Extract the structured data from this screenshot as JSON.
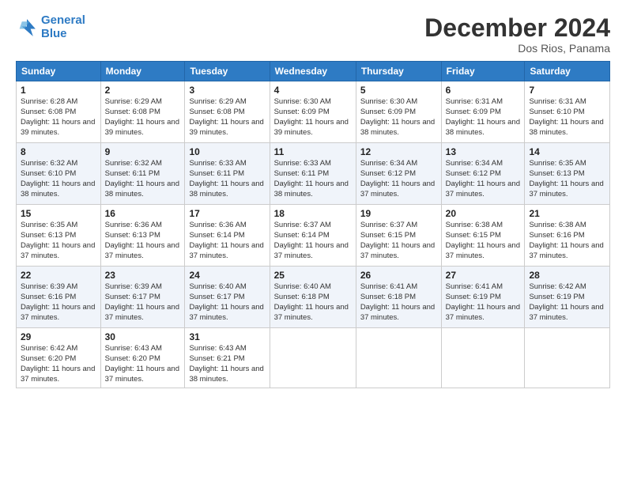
{
  "header": {
    "logo_line1": "General",
    "logo_line2": "Blue",
    "month_title": "December 2024",
    "location": "Dos Rios, Panama"
  },
  "weekdays": [
    "Sunday",
    "Monday",
    "Tuesday",
    "Wednesday",
    "Thursday",
    "Friday",
    "Saturday"
  ],
  "weeks": [
    [
      {
        "day": "1",
        "info": "Sunrise: 6:28 AM\nSunset: 6:08 PM\nDaylight: 11 hours and 39 minutes."
      },
      {
        "day": "2",
        "info": "Sunrise: 6:29 AM\nSunset: 6:08 PM\nDaylight: 11 hours and 39 minutes."
      },
      {
        "day": "3",
        "info": "Sunrise: 6:29 AM\nSunset: 6:08 PM\nDaylight: 11 hours and 39 minutes."
      },
      {
        "day": "4",
        "info": "Sunrise: 6:30 AM\nSunset: 6:09 PM\nDaylight: 11 hours and 39 minutes."
      },
      {
        "day": "5",
        "info": "Sunrise: 6:30 AM\nSunset: 6:09 PM\nDaylight: 11 hours and 38 minutes."
      },
      {
        "day": "6",
        "info": "Sunrise: 6:31 AM\nSunset: 6:09 PM\nDaylight: 11 hours and 38 minutes."
      },
      {
        "day": "7",
        "info": "Sunrise: 6:31 AM\nSunset: 6:10 PM\nDaylight: 11 hours and 38 minutes."
      }
    ],
    [
      {
        "day": "8",
        "info": "Sunrise: 6:32 AM\nSunset: 6:10 PM\nDaylight: 11 hours and 38 minutes."
      },
      {
        "day": "9",
        "info": "Sunrise: 6:32 AM\nSunset: 6:11 PM\nDaylight: 11 hours and 38 minutes."
      },
      {
        "day": "10",
        "info": "Sunrise: 6:33 AM\nSunset: 6:11 PM\nDaylight: 11 hours and 38 minutes."
      },
      {
        "day": "11",
        "info": "Sunrise: 6:33 AM\nSunset: 6:11 PM\nDaylight: 11 hours and 38 minutes."
      },
      {
        "day": "12",
        "info": "Sunrise: 6:34 AM\nSunset: 6:12 PM\nDaylight: 11 hours and 37 minutes."
      },
      {
        "day": "13",
        "info": "Sunrise: 6:34 AM\nSunset: 6:12 PM\nDaylight: 11 hours and 37 minutes."
      },
      {
        "day": "14",
        "info": "Sunrise: 6:35 AM\nSunset: 6:13 PM\nDaylight: 11 hours and 37 minutes."
      }
    ],
    [
      {
        "day": "15",
        "info": "Sunrise: 6:35 AM\nSunset: 6:13 PM\nDaylight: 11 hours and 37 minutes."
      },
      {
        "day": "16",
        "info": "Sunrise: 6:36 AM\nSunset: 6:13 PM\nDaylight: 11 hours and 37 minutes."
      },
      {
        "day": "17",
        "info": "Sunrise: 6:36 AM\nSunset: 6:14 PM\nDaylight: 11 hours and 37 minutes."
      },
      {
        "day": "18",
        "info": "Sunrise: 6:37 AM\nSunset: 6:14 PM\nDaylight: 11 hours and 37 minutes."
      },
      {
        "day": "19",
        "info": "Sunrise: 6:37 AM\nSunset: 6:15 PM\nDaylight: 11 hours and 37 minutes."
      },
      {
        "day": "20",
        "info": "Sunrise: 6:38 AM\nSunset: 6:15 PM\nDaylight: 11 hours and 37 minutes."
      },
      {
        "day": "21",
        "info": "Sunrise: 6:38 AM\nSunset: 6:16 PM\nDaylight: 11 hours and 37 minutes."
      }
    ],
    [
      {
        "day": "22",
        "info": "Sunrise: 6:39 AM\nSunset: 6:16 PM\nDaylight: 11 hours and 37 minutes."
      },
      {
        "day": "23",
        "info": "Sunrise: 6:39 AM\nSunset: 6:17 PM\nDaylight: 11 hours and 37 minutes."
      },
      {
        "day": "24",
        "info": "Sunrise: 6:40 AM\nSunset: 6:17 PM\nDaylight: 11 hours and 37 minutes."
      },
      {
        "day": "25",
        "info": "Sunrise: 6:40 AM\nSunset: 6:18 PM\nDaylight: 11 hours and 37 minutes."
      },
      {
        "day": "26",
        "info": "Sunrise: 6:41 AM\nSunset: 6:18 PM\nDaylight: 11 hours and 37 minutes."
      },
      {
        "day": "27",
        "info": "Sunrise: 6:41 AM\nSunset: 6:19 PM\nDaylight: 11 hours and 37 minutes."
      },
      {
        "day": "28",
        "info": "Sunrise: 6:42 AM\nSunset: 6:19 PM\nDaylight: 11 hours and 37 minutes."
      }
    ],
    [
      {
        "day": "29",
        "info": "Sunrise: 6:42 AM\nSunset: 6:20 PM\nDaylight: 11 hours and 37 minutes."
      },
      {
        "day": "30",
        "info": "Sunrise: 6:43 AM\nSunset: 6:20 PM\nDaylight: 11 hours and 37 minutes."
      },
      {
        "day": "31",
        "info": "Sunrise: 6:43 AM\nSunset: 6:21 PM\nDaylight: 11 hours and 38 minutes."
      },
      {
        "day": "",
        "info": ""
      },
      {
        "day": "",
        "info": ""
      },
      {
        "day": "",
        "info": ""
      },
      {
        "day": "",
        "info": ""
      }
    ]
  ]
}
